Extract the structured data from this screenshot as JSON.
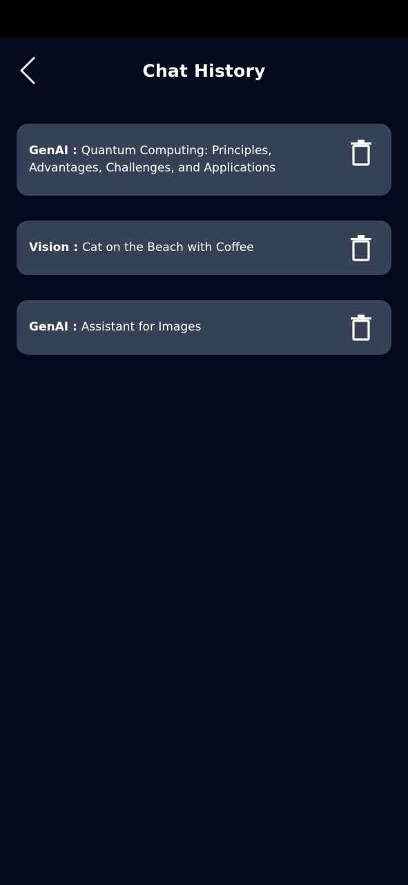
{
  "header": {
    "title": "Chat History",
    "back_icon": "chevron-left-icon"
  },
  "history": {
    "items": [
      {
        "category": "GenAI",
        "separator": " : ",
        "title": "Quantum Computing: Principles, Advantages, Challenges, and Applications",
        "delete_icon": "trash-icon"
      },
      {
        "category": "Vision",
        "separator": " : ",
        "title": "Cat on the Beach with Coffee",
        "delete_icon": "trash-icon"
      },
      {
        "category": "GenAI",
        "separator": " : ",
        "title": "Assistant for Images",
        "delete_icon": "trash-icon"
      }
    ]
  },
  "colors": {
    "background": "#03091a",
    "card": "#364356",
    "text": "#ffffff"
  }
}
